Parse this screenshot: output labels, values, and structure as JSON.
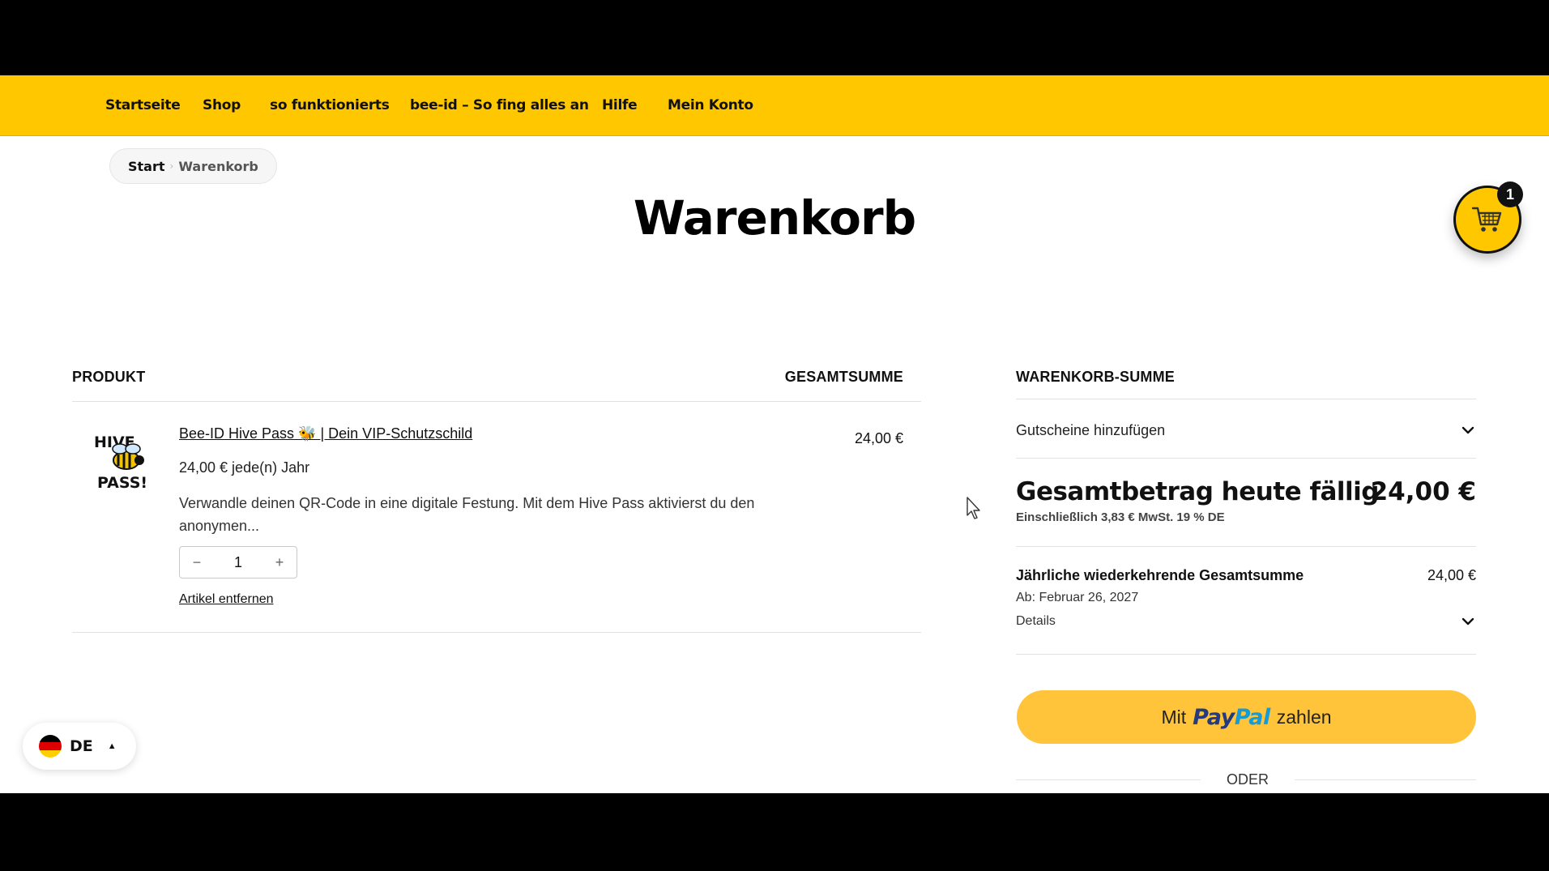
{
  "nav": {
    "items": [
      {
        "label": "Startseite"
      },
      {
        "label": "Shop"
      },
      {
        "label": "so funktionierts"
      },
      {
        "label": "bee-id – So fing alles an"
      },
      {
        "label": "Hilfe"
      },
      {
        "label": "Mein Konto"
      }
    ]
  },
  "breadcrumb": {
    "start": "Start",
    "separator": "›",
    "current": "Warenkorb"
  },
  "page_title": "Warenkorb",
  "cart_badge": {
    "count": "1",
    "icon": "shopping-cart-icon"
  },
  "table": {
    "col_product": "PRODUKT",
    "col_total": "GESAMTSUMME",
    "items": [
      {
        "thumb_text_top": "HIVE",
        "thumb_text_bottom": "PASS!",
        "name_prefix": "Bee-ID Hive Pass ",
        "name_emoji": "🐝",
        "name_suffix": " | Dein VIP-Schutzschild",
        "price_line": "24,00 € jede(n) Jahr",
        "description": "Verwandle deinen QR-Code in eine digitale Festung. Mit dem Hive Pass aktivierst du den anonymen...",
        "quantity": "1",
        "qty_minus": "−",
        "qty_plus": "+",
        "remove_label": "Artikel entfernen",
        "row_total": "24,00 €"
      }
    ]
  },
  "summary": {
    "heading": "WARENKORB-SUMME",
    "coupon_label": "Gutscheine hinzufügen",
    "total_label": "Gesamtbetrag heute fällig",
    "total_amount": "24,00 €",
    "tax_note": "Einschließlich 3,83 € MwSt. 19 % DE",
    "recurring_label": "Jährliche wiederkehrende Gesamtsumme",
    "recurring_amount": "24,00 €",
    "recurring_start": "Ab: Februar 26, 2027",
    "details_label": "Details",
    "paypal": {
      "prefix": "Mit",
      "logo_pay": "Pay",
      "logo_pal": "Pal",
      "suffix": "zahlen"
    },
    "or_label": "ODER"
  },
  "language": {
    "code": "DE",
    "flag_colors": [
      "#000000",
      "#dd0000",
      "#ffce00"
    ]
  },
  "colors": {
    "brand_yellow": "#ffc700",
    "paypal_yellow": "#ffc439"
  }
}
